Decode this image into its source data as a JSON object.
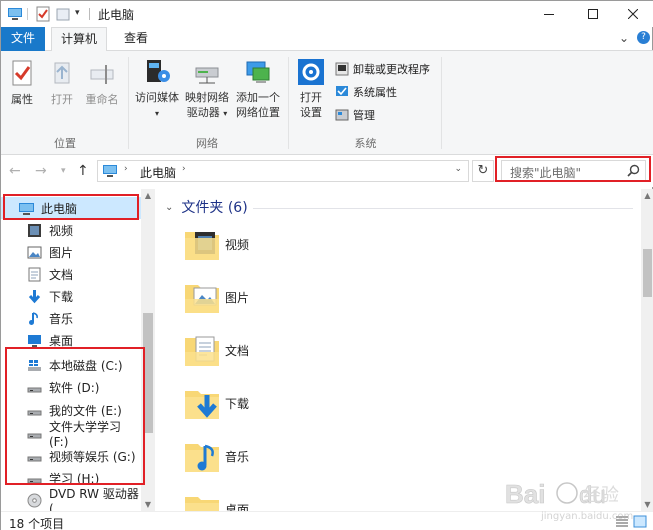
{
  "window": {
    "title": "此电脑"
  },
  "ribbon_tabs": [
    {
      "label": "文件"
    },
    {
      "label": "计算机"
    },
    {
      "label": "查看"
    }
  ],
  "ribbon": {
    "location": {
      "label": "位置",
      "buttons": [
        {
          "label": "属性",
          "icon": "properties-icon"
        },
        {
          "label": "打开",
          "icon": "open-icon"
        },
        {
          "label": "重命名",
          "icon": "rename-icon"
        }
      ]
    },
    "network": {
      "label": "网络",
      "access_media": "访问媒体",
      "map_drive_line1": "映射网络",
      "map_drive_line2": "驱动器",
      "add_location_line1": "添加一个",
      "add_location_line2": "网络位置"
    },
    "system": {
      "label": "系统",
      "open_settings_line1": "打开",
      "open_settings_line2": "设置",
      "uninstall": "卸载或更改程序",
      "system_properties": "系统属性",
      "manage": "管理"
    }
  },
  "address": {
    "path": "此电脑",
    "search_placeholder": "搜索\"此电脑\""
  },
  "nav_pane": {
    "items": [
      {
        "label": "此电脑",
        "icon": "computer-icon"
      },
      {
        "label": "视频",
        "icon": "video-icon"
      },
      {
        "label": "图片",
        "icon": "picture-icon"
      },
      {
        "label": "文档",
        "icon": "document-icon"
      },
      {
        "label": "下载",
        "icon": "download-icon"
      },
      {
        "label": "音乐",
        "icon": "music-icon"
      },
      {
        "label": "桌面",
        "icon": "desktop-icon"
      },
      {
        "label": "本地磁盘 (C:)",
        "icon": "windows-drive-icon"
      },
      {
        "label": "软件 (D:)",
        "icon": "drive-icon"
      },
      {
        "label": "我的文件 (E:)",
        "icon": "drive-icon"
      },
      {
        "label": "文件大学学习 (F:)",
        "icon": "drive-icon"
      },
      {
        "label": "视频等娱乐 (G:)",
        "icon": "drive-icon"
      },
      {
        "label": "学习 (H:)",
        "icon": "drive-icon"
      },
      {
        "label": "DVD RW 驱动器 (",
        "icon": "dvd-icon"
      }
    ]
  },
  "content": {
    "group_title": "文件夹 (6)",
    "folders": [
      {
        "label": "视频",
        "icon": "video-folder-icon"
      },
      {
        "label": "图片",
        "icon": "picture-folder-icon"
      },
      {
        "label": "文档",
        "icon": "document-folder-icon"
      },
      {
        "label": "下载",
        "icon": "download-folder-icon"
      },
      {
        "label": "音乐",
        "icon": "music-folder-icon"
      },
      {
        "label": "桌面",
        "icon": "desktop-folder-icon"
      }
    ]
  },
  "status_bar": {
    "item_count": "18 个项目"
  },
  "watermark": {
    "text": "Baidu 经验",
    "url_text": "jingyan.baidu.com"
  },
  "colors": {
    "accent": "#1979ca",
    "selection": "#cce8ff",
    "highlight": "#e12026",
    "folder": "#f8d775"
  }
}
